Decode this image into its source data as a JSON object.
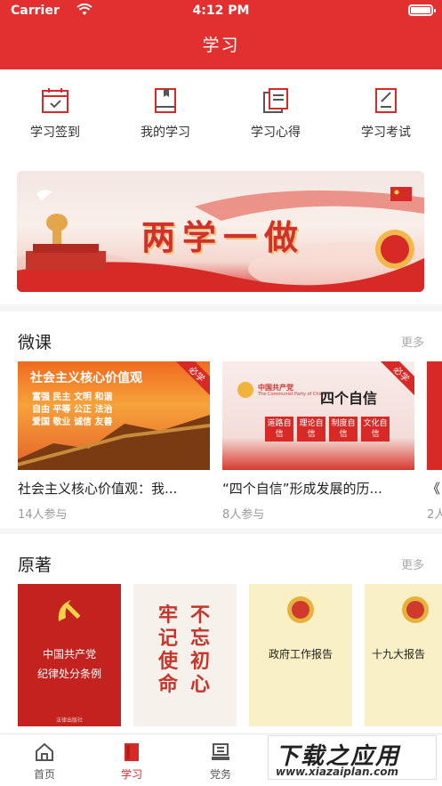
{
  "status": {
    "carrier": "Carrier",
    "time": "4:12 PM"
  },
  "nav": {
    "title": "学习"
  },
  "quick": [
    {
      "label": "学习签到",
      "icon": "calendar-check-icon"
    },
    {
      "label": "我的学习",
      "icon": "book-icon"
    },
    {
      "label": "学习心得",
      "icon": "notes-icon"
    },
    {
      "label": "学习考试",
      "icon": "exam-icon"
    }
  ],
  "banner": {
    "title": "两学一做",
    "active_dot": 2,
    "dot_count": 3
  },
  "micro": {
    "title": "微课",
    "more": "更多",
    "items": [
      {
        "title": "社会主义核心价值观：我...",
        "meta": "14人参与",
        "badge": "必学",
        "thumb_title": "社会主义核心价值观",
        "thumb_lines": [
          "富强 民主 文明 和谐",
          "自由 平等 公正 法治",
          "爱国 敬业 诚信 友善"
        ]
      },
      {
        "title": "“四个自信”形成发展的历...",
        "meta": "8人参与",
        "badge": "必学",
        "thumb_title": "四个自信",
        "thumb_party": "中国共产党",
        "thumb_party_en": "The Communist Party of China",
        "thumb_boxes": [
          "道路自信",
          "理论自信",
          "制度自信",
          "文化自信"
        ]
      },
      {
        "title": "《",
        "meta": "2人"
      }
    ]
  },
  "originals": {
    "title": "原著",
    "more": "更多",
    "books": [
      {
        "lines": [
          "中国共产党",
          "纪律处分条例"
        ],
        "publisher": "法律出版社"
      },
      {
        "lines": [
          "牢记使命",
          "不忘初心"
        ]
      },
      {
        "lines": [
          "政府工作报告"
        ]
      },
      {
        "lines": [
          "十九大报告"
        ]
      }
    ]
  },
  "tabs": [
    {
      "label": "首页",
      "icon": "home-icon",
      "active": false
    },
    {
      "label": "学习",
      "icon": "study-book-icon",
      "active": true
    },
    {
      "label": "党务",
      "icon": "party-affairs-icon",
      "active": false
    }
  ],
  "watermark": {
    "line1": "下载之应用",
    "line2": "www.xiazaiplan.com"
  },
  "colors": {
    "brand": "#e23030",
    "text": "#222222",
    "muted": "#999999"
  }
}
